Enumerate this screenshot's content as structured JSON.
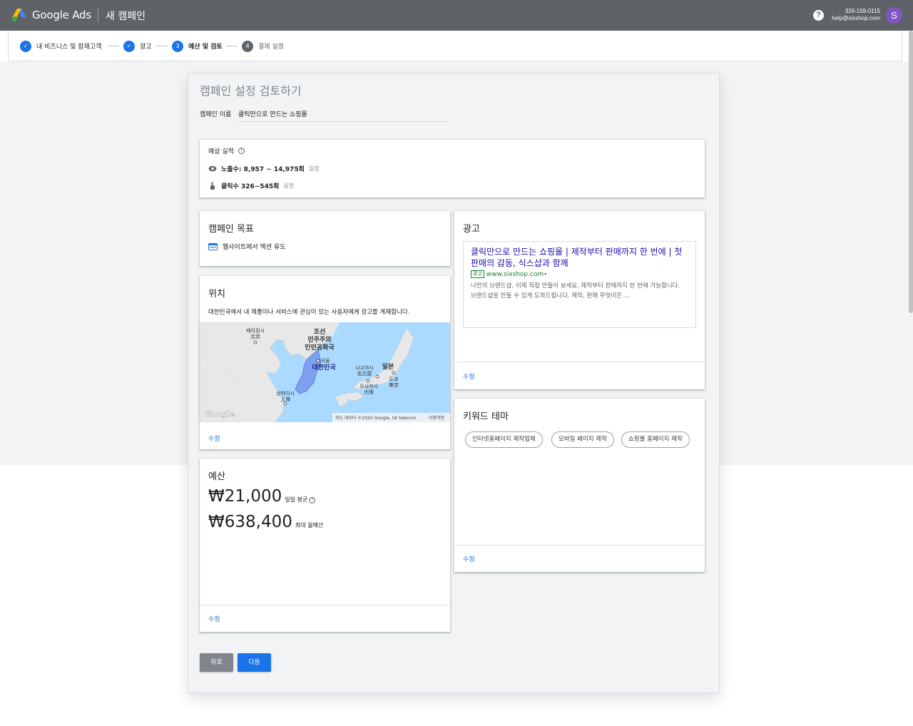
{
  "app": {
    "brand": "Google Ads",
    "page_title": "새 캠페인"
  },
  "account": {
    "id": "326-159-0115",
    "email": "help@sixshop.com",
    "avatar_letter": "S",
    "help_symbol": "?"
  },
  "steps": [
    {
      "label": "내 비즈니스 및 잠재고객",
      "number": "✓",
      "state": "done"
    },
    {
      "label": "광고",
      "number": "✓",
      "state": "done"
    },
    {
      "label": "예산 및 검토",
      "number": "3",
      "state": "current"
    },
    {
      "label": "결제 설정",
      "number": "4",
      "state": "todo"
    }
  ],
  "review": {
    "title": "캠페인 설정 검토하기",
    "name_label": "캠페인 이름",
    "name_value": "클릭만으로 만드는 쇼핑몰"
  },
  "performance": {
    "title": "예상 실적",
    "impressions": "노출수: 8,957 ~ 14,975회",
    "clicks": "클릭수 326~545회",
    "period": "월별"
  },
  "goal": {
    "title": "캠페인 목표",
    "value": "웹사이트에서 액션 유도"
  },
  "location": {
    "title": "위치",
    "description": "대한민국에서 내 제품이나 서비스에 관심이 있는 사용자에게 광고를 게재합니다.",
    "map_labels": {
      "beijing_ko": "베이징시",
      "beijing_zh": "北京",
      "nk1": "조선",
      "nk2": "민주주의",
      "nk3": "인민공화국",
      "seoul": "서울",
      "korea": "대한민국",
      "nagoya_ko": "나고야시",
      "nagoya_ja": "名古屋",
      "japan": "일본",
      "osaka_ko": "오사카시",
      "osaka_ja": "大阪",
      "tokyo_ko": "도쿄",
      "tokyo_ja": "東京",
      "shanghai_ko": "상하이시",
      "shanghai_zh": "上海",
      "google": "Google",
      "attribution": "지도 데이터 ©2020 Google, SK telecom",
      "terms": "이용약관"
    },
    "edit": "수정"
  },
  "ad": {
    "title": "광고",
    "headline": "클릭만으로 만드는 쇼핑몰 | 제작부터 판매까지 한 번에 | 첫 판매의 감동, 식스샵과 함께",
    "badge": "광고",
    "url": "www.sixshop.com",
    "description": "나만의 브랜드샵, 이제 직접 만들어 보세요. 제작부터 판매까지 한 번에 가능합니다. 브랜드샵을 만들 수 있게 도와드립니다. 제작, 판매 무엇이든 ...",
    "edit": "수정"
  },
  "keywords": {
    "title": "키워드 테마",
    "chips": [
      "인터넷홈페이지 제작업체",
      "모바일 페이지 제작",
      "쇼핑몰 홈페이지 제작"
    ],
    "edit": "수정"
  },
  "budget": {
    "title": "예산",
    "daily": "₩21,000",
    "daily_label": "일일 평균",
    "monthly": "₩638,400",
    "monthly_label": "최대 월예산",
    "edit": "수정"
  },
  "buttons": {
    "back": "뒤로",
    "next": "다음"
  },
  "colors": {
    "topbar": "#5f6368",
    "accent": "#1a73e8",
    "map_water": "#aadaff",
    "korea_fill": "#7fa0f0",
    "ad_green": "#188038",
    "ad_headline": "#1a0dab",
    "avatar": "#7e57c2"
  }
}
